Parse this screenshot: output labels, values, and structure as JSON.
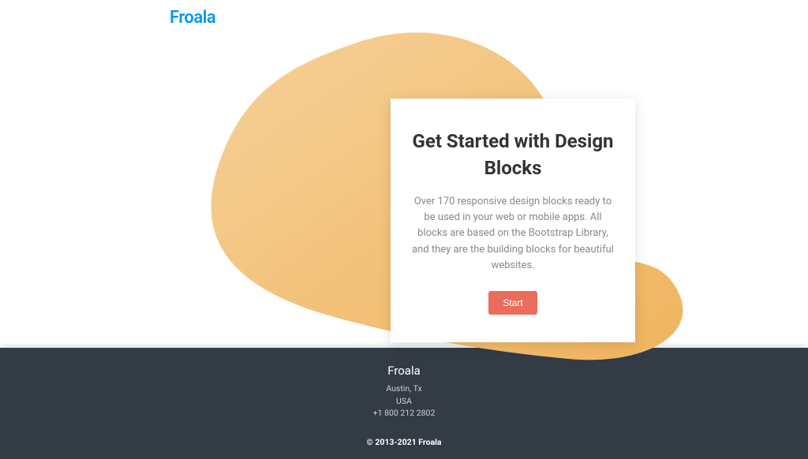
{
  "header": {
    "logo": "Froala"
  },
  "hero": {
    "title": "Get Started with Design Blocks",
    "description": "Over 170 responsive design blocks ready to be used in your web or mobile apps. All blocks are based on the Bootstrap Library, and they are the building blocks for beautiful websites.",
    "button_label": "Start"
  },
  "footer": {
    "company": "Froala",
    "city": "Austin, Tx",
    "country": "USA",
    "phone": "+1 800 212 2802",
    "copyright": "© 2013-2021 Froala"
  },
  "colors": {
    "brand": "#0098f7",
    "accent": "#e96d5c",
    "blob": "#f2c078",
    "footer_bg": "#333b44"
  }
}
